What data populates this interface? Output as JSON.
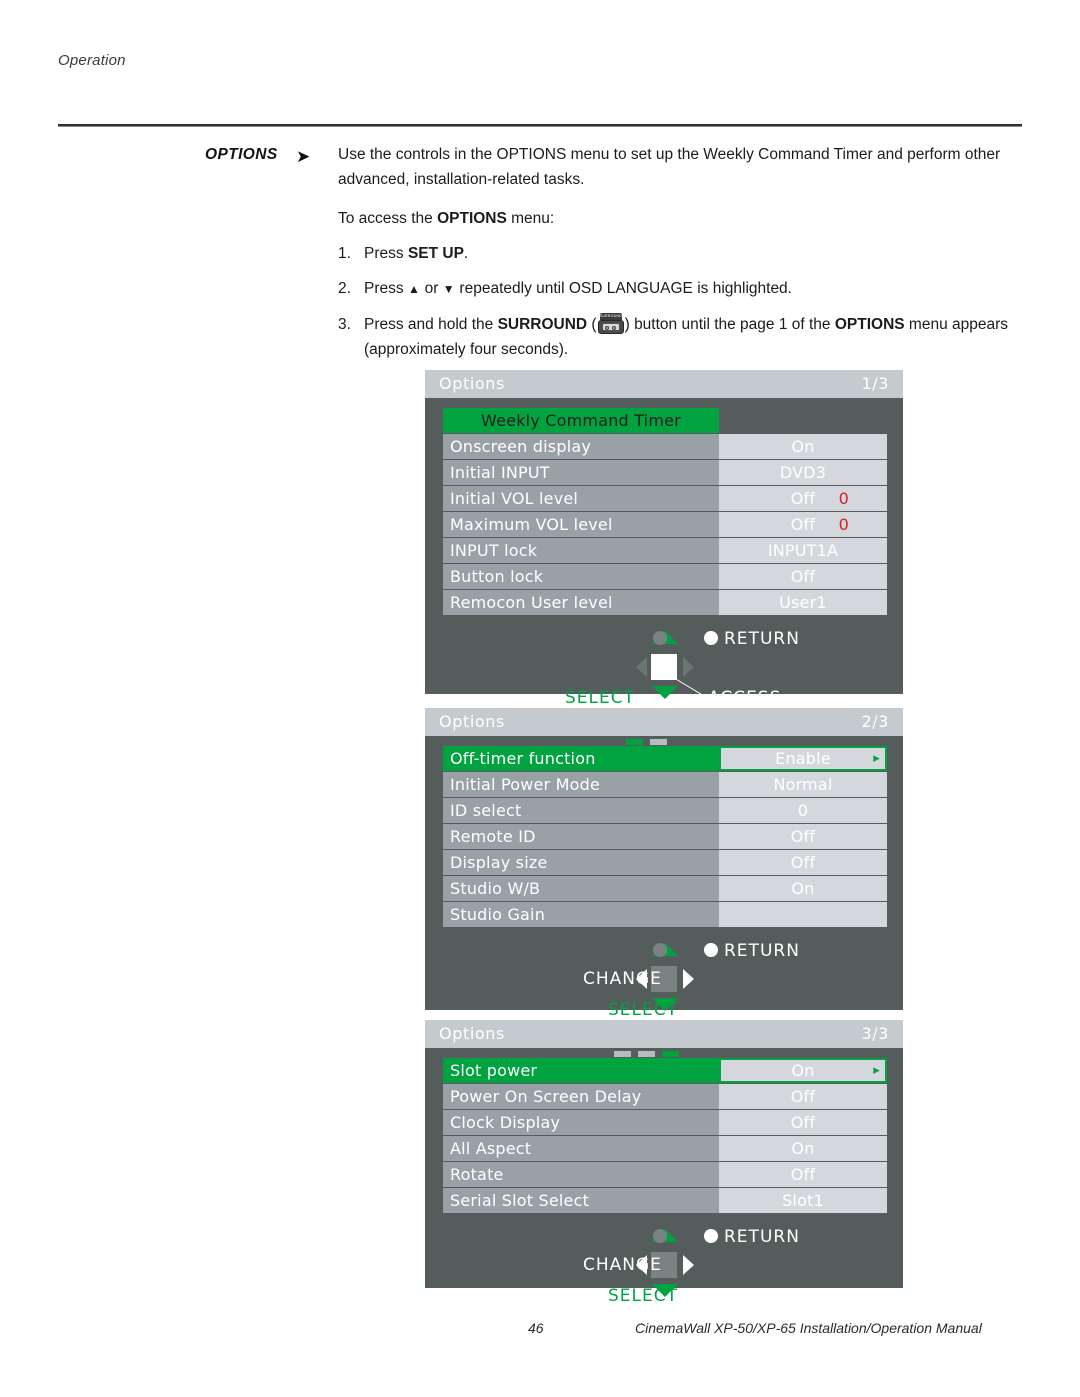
{
  "page": {
    "running_head": "Operation",
    "footer_page_number": "46",
    "footer_text": "CinemaWall XP-50/XP-65 Installation/Operation Manual"
  },
  "section": {
    "label": "OPTIONS",
    "arrow_icon": "right-arrow-icon",
    "intro_part1": "Use the controls in the OPTIONS menu to set up the Weekly Command Timer and perform other advanced, installation-related tasks.",
    "access_line_pre": "To access the ",
    "access_line_bold": "OPTIONS",
    "access_line_post": " menu:",
    "steps": [
      {
        "num": "1.",
        "pre": "Press ",
        "bold": "SET UP",
        "post": "."
      },
      {
        "num": "2.",
        "pre": "Press ",
        "up_glyph": "▲",
        "mid": " or ",
        "down_glyph": "▼",
        "post": " repeatedly until OSD LANGUAGE is highlighted."
      },
      {
        "num": "3.",
        "pre": "Press and hold the ",
        "bold": "SURROUND",
        "paren_open": " (",
        "button_icon_label": "SURROUND",
        "paren_close": ") ",
        "mid": "button until the page 1 of the ",
        "bold2": "OPTIONS",
        "post": " menu appears (approximately four seconds)."
      }
    ]
  },
  "colors": {
    "osd_background": "#555c5c",
    "osd_title_bar": "#c5cace",
    "label_cell": "#9aa1a6",
    "value_cell": "#d4d8dc",
    "accent_green": "#00a340",
    "value_number_red": "#e01b24"
  },
  "osd_panels": [
    {
      "name": "options-page-1",
      "title": "Options",
      "page_indicator": "1/3",
      "page_dots": [],
      "header_row": {
        "label": "Weekly Command Timer"
      },
      "rows": [
        {
          "label": "Onscreen display",
          "value": "On",
          "number": "",
          "selected": false,
          "chevron": false
        },
        {
          "label": "Initial INPUT",
          "value": "DVD3",
          "number": "",
          "selected": false,
          "chevron": false
        },
        {
          "label": "Initial VOL level",
          "value": "Off",
          "number": "0",
          "selected": false,
          "chevron": false
        },
        {
          "label": "Maximum VOL level",
          "value": "Off",
          "number": "0",
          "selected": false,
          "chevron": false
        },
        {
          "label": "INPUT lock",
          "value": "INPUT1A",
          "number": "",
          "selected": false,
          "chevron": false
        },
        {
          "label": "Button lock",
          "value": "Off",
          "number": "",
          "selected": false,
          "chevron": false
        },
        {
          "label": "Remocon User level",
          "value": "User1",
          "number": "",
          "selected": false,
          "chevron": false
        }
      ],
      "nav": {
        "return_label": "RETURN",
        "select_label": "SELECT",
        "access_label": "ACCESS",
        "change_label": "",
        "style": "access"
      }
    },
    {
      "name": "options-page-2",
      "title": "Options",
      "page_indicator": "2/3",
      "page_dots": [
        "on",
        "off"
      ],
      "header_row": null,
      "rows": [
        {
          "label": "Off-timer function",
          "value": "Enable",
          "number": "",
          "selected": true,
          "chevron": true
        },
        {
          "label": "Initial Power Mode",
          "value": "Normal",
          "number": "",
          "selected": false,
          "chevron": false
        },
        {
          "label": "ID select",
          "value": "0",
          "number": "",
          "selected": false,
          "chevron": false
        },
        {
          "label": "Remote ID",
          "value": "Off",
          "number": "",
          "selected": false,
          "chevron": false
        },
        {
          "label": "Display size",
          "value": "Off",
          "number": "",
          "selected": false,
          "chevron": false
        },
        {
          "label": "Studio W/B",
          "value": "On",
          "number": "",
          "selected": false,
          "chevron": false
        },
        {
          "label": "Studio Gain",
          "value": "",
          "number": "",
          "selected": false,
          "chevron": false
        }
      ],
      "nav": {
        "return_label": "RETURN",
        "select_label": "SELECT",
        "access_label": "",
        "change_label": "CHANGE",
        "style": "change"
      }
    },
    {
      "name": "options-page-3",
      "title": "Options",
      "page_indicator": "3/3",
      "page_dots": [
        "off",
        "off",
        "on"
      ],
      "header_row": null,
      "rows": [
        {
          "label": "Slot power",
          "value": "On",
          "number": "",
          "selected": true,
          "chevron": true
        },
        {
          "label": "Power On Screen Delay",
          "value": "Off",
          "number": "",
          "selected": false,
          "chevron": false
        },
        {
          "label": "Clock Display",
          "value": "Off",
          "number": "",
          "selected": false,
          "chevron": false
        },
        {
          "label": "All Aspect",
          "value": "On",
          "number": "",
          "selected": false,
          "chevron": false
        },
        {
          "label": "Rotate",
          "value": "Off",
          "number": "",
          "selected": false,
          "chevron": false
        },
        {
          "label": "Serial Slot Select",
          "value": "Slot1",
          "number": "",
          "selected": false,
          "chevron": false
        }
      ],
      "nav": {
        "return_label": "RETURN",
        "select_label": "SELECT",
        "access_label": "",
        "change_label": "CHANGE",
        "style": "change"
      }
    }
  ]
}
